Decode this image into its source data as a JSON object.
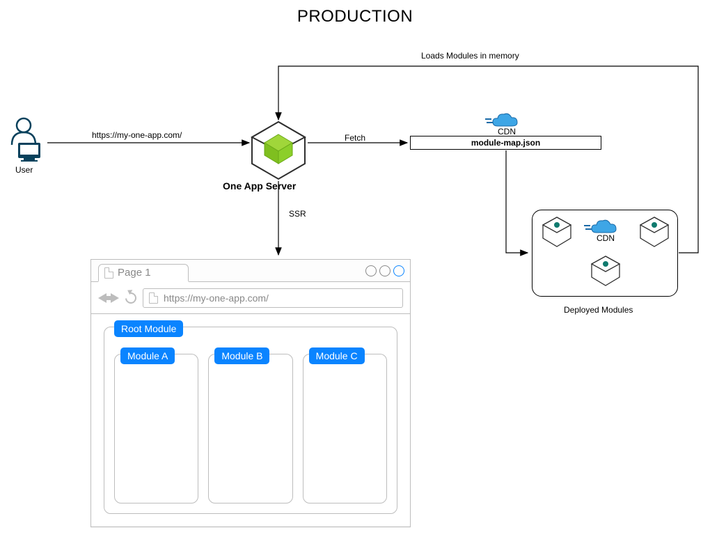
{
  "title": "PRODUCTION",
  "user_label": "User",
  "server_label": "One App Server",
  "edges": {
    "user_to_server": "https://my-one-app.com/",
    "server_to_modulemap": "Fetch",
    "server_to_browser": "SSR",
    "deployed_to_server": "Loads Modules in memory"
  },
  "cdn": {
    "top_label": "CDN",
    "deployed_label": "CDN"
  },
  "module_map_filename": "module-map.json",
  "deployed_modules_label": "Deployed Modules",
  "browser": {
    "tab_title": "Page 1",
    "url": "https://my-one-app.com/",
    "root_module": "Root Module",
    "modules": [
      "Module A",
      "Module B",
      "Module C"
    ]
  }
}
